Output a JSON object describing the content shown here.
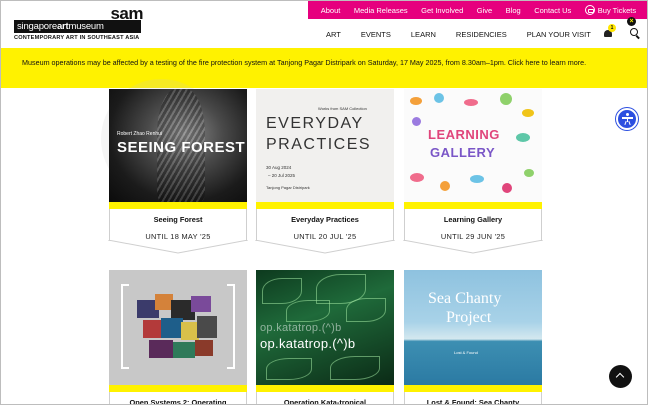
{
  "utility_nav": {
    "items": [
      "About",
      "Media Releases",
      "Get Involved",
      "Give",
      "Blog",
      "Contact Us"
    ],
    "tickets_label": "Buy Tickets"
  },
  "logo": {
    "sam": "sam",
    "name_prefix": "singapore",
    "name_bold": "art",
    "name_suffix": "museum",
    "tagline": "CONTEMPORARY ART IN SOUTHEAST ASIA"
  },
  "main_nav": {
    "items": [
      "ART",
      "EVENTS",
      "LEARN",
      "RESIDENCIES",
      "PLAN YOUR VISIT"
    ],
    "notification_count": "1"
  },
  "alert": {
    "text": "Museum operations may be affected by a testing of the fire protection system at Tanjong Pagar Distripark on Saturday, 17 May 2025, from 8.30am–1pm. Click here to learn more.",
    "close_symbol": "×"
  },
  "cards": [
    {
      "title": "Seeing Forest",
      "date": "UNTIL 18 MAY '25",
      "art_artist": "Robert Zhao Renhui",
      "art_title": "SEEING FOREST"
    },
    {
      "title": "Everyday Practices",
      "date": "UNTIL 20 JUL '25",
      "art_collection": "Works from SAM Collection",
      "art_title_1": "EVERYDAY",
      "art_title_2": "PRACTICES",
      "art_date_1": "30 Aug 2024",
      "art_date_2": "– 20 Jul 2025",
      "art_venue": "Tanjong Pagar Distripark"
    },
    {
      "title": "Learning Gallery",
      "date": "UNTIL 29 JUN '25",
      "art_title_1": "LEARNING",
      "art_title_2": "GALLERY"
    },
    {
      "title": "Open Systems 2: Operating"
    },
    {
      "title": "Operation Kata-tropical",
      "art_title": "op.katatrop.(^)b"
    },
    {
      "title": "Lost & Found: Sea Chanty",
      "art_title_1": "Sea Chanty",
      "art_title_2": "Project",
      "art_subtitle": "Lost & Found"
    }
  ],
  "colors": {
    "utility_bar": "#e6007e",
    "alert_bg": "#fff200",
    "accessibility": "#2c4fe0"
  }
}
